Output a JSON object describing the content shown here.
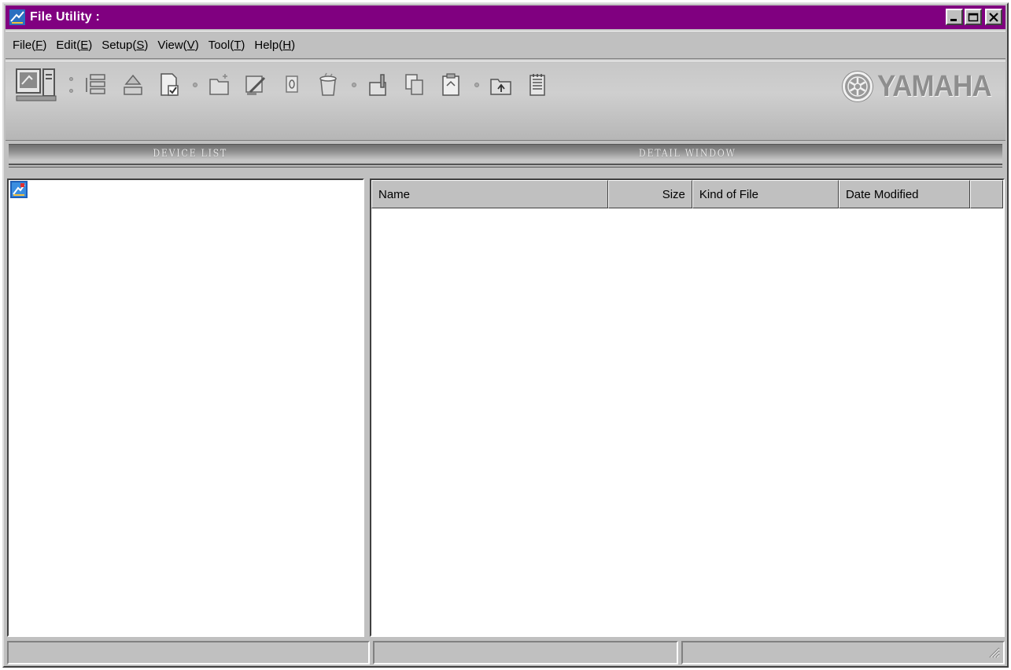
{
  "window": {
    "title": "File Utility :"
  },
  "title_buttons": {
    "minimize": "minimize",
    "maximize": "maximize",
    "close": "close"
  },
  "menu": [
    {
      "label": "File(",
      "key": "F",
      "end": ")"
    },
    {
      "label": "Edit(",
      "key": "E",
      "end": ")"
    },
    {
      "label": "Setup(",
      "key": "S",
      "end": ")"
    },
    {
      "label": "View(",
      "key": "V",
      "end": ")"
    },
    {
      "label": "Tool(",
      "key": "T",
      "end": ")"
    },
    {
      "label": "Help(",
      "key": "H",
      "end": ")"
    }
  ],
  "toolbar": {
    "brand": "YAMAHA",
    "section_left": "DEVICE LIST",
    "section_right": "DETAIL WINDOW",
    "icons": [
      "computer-icon",
      "device-list-icon",
      "eject-icon",
      "file-check-icon",
      "new-folder-icon",
      "edit-icon",
      "info-icon",
      "trash-icon",
      "paste-icon",
      "copy-icon",
      "clipboard-icon",
      "folder-up-icon",
      "notes-icon"
    ]
  },
  "detail": {
    "columns": [
      "Name",
      "Size",
      "Kind of File",
      "Date Modified"
    ]
  },
  "colors": {
    "titlebar": "#800080",
    "face": "#c0c0c0"
  }
}
